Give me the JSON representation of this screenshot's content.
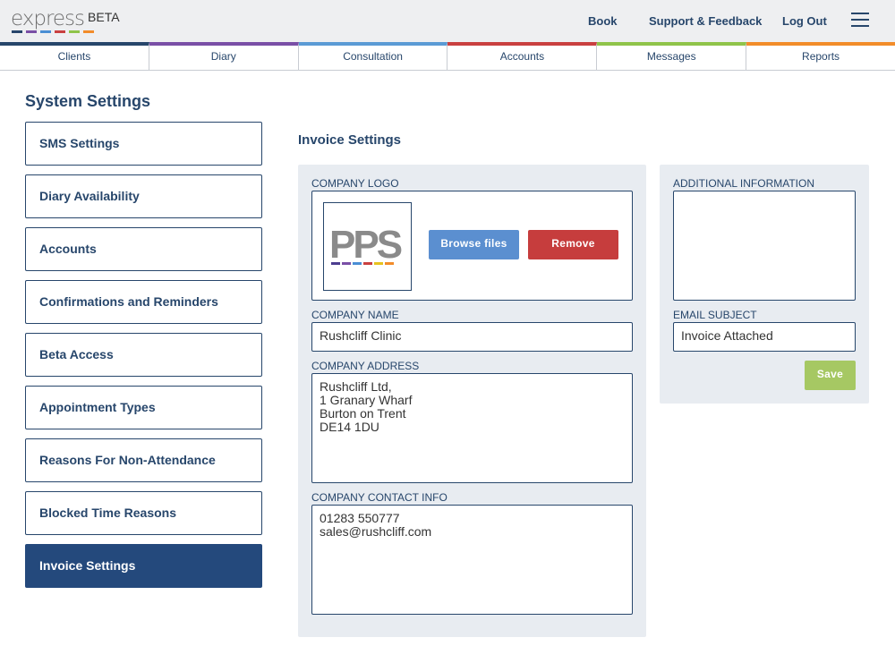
{
  "header": {
    "logo_word": "express",
    "logo_beta": "BETA",
    "logo_dash_colors": [
      "#27466b",
      "#7a4fa6",
      "#4a8ed4",
      "#c94040",
      "#8fc44a",
      "#f28c2a"
    ],
    "nav": [
      "Book",
      "Support & Feedback",
      "Log Out"
    ],
    "menu_icon": "hamburger-icon"
  },
  "tabs": [
    {
      "label": "Clients",
      "color": "#27466b"
    },
    {
      "label": "Diary",
      "color": "#7a4fa6"
    },
    {
      "label": "Consultation",
      "color": "#5b9bd5"
    },
    {
      "label": "Accounts",
      "color": "#c94040"
    },
    {
      "label": "Messages",
      "color": "#8fc44a"
    },
    {
      "label": "Reports",
      "color": "#f28c2a"
    }
  ],
  "sidebar": {
    "title": "System Settings",
    "items": [
      {
        "label": "SMS Settings"
      },
      {
        "label": "Diary Availability"
      },
      {
        "label": "Accounts"
      },
      {
        "label": "Confirmations and Reminders"
      },
      {
        "label": "Beta Access"
      },
      {
        "label": "Appointment Types"
      },
      {
        "label": "Reasons For Non-Attendance"
      },
      {
        "label": "Blocked Time Reasons"
      },
      {
        "label": "Invoice Settings",
        "active": true
      }
    ]
  },
  "invoice": {
    "title": "Invoice Settings",
    "company_logo_label": "COMPANY LOGO",
    "logo_text": "PPS",
    "browse_label": "Browse files",
    "remove_label": "Remove",
    "company_name_label": "COMPANY NAME",
    "company_name_value": "Rushcliff Clinic",
    "company_address_label": "COMPANY ADDRESS",
    "company_address_value": "Rushcliff Ltd,\n1 Granary Wharf\nBurton on Trent\nDE14 1DU",
    "company_contact_label": "COMPANY CONTACT INFO",
    "company_contact_value": "01283 550777\nsales@rushcliff.com",
    "additional_info_label": "ADDITIONAL INFORMATION",
    "additional_info_value": "",
    "email_subject_label": "EMAIL SUBJECT",
    "email_subject_value": "Invoice Attached",
    "save_label": "Save"
  },
  "colors": {
    "brand_navy": "#27466b",
    "active_item": "#24497c",
    "browse_btn": "#5b8fd0",
    "remove_btn": "#c63d3d",
    "save_btn": "#a6c863",
    "card_bg": "#e8ecf1"
  }
}
